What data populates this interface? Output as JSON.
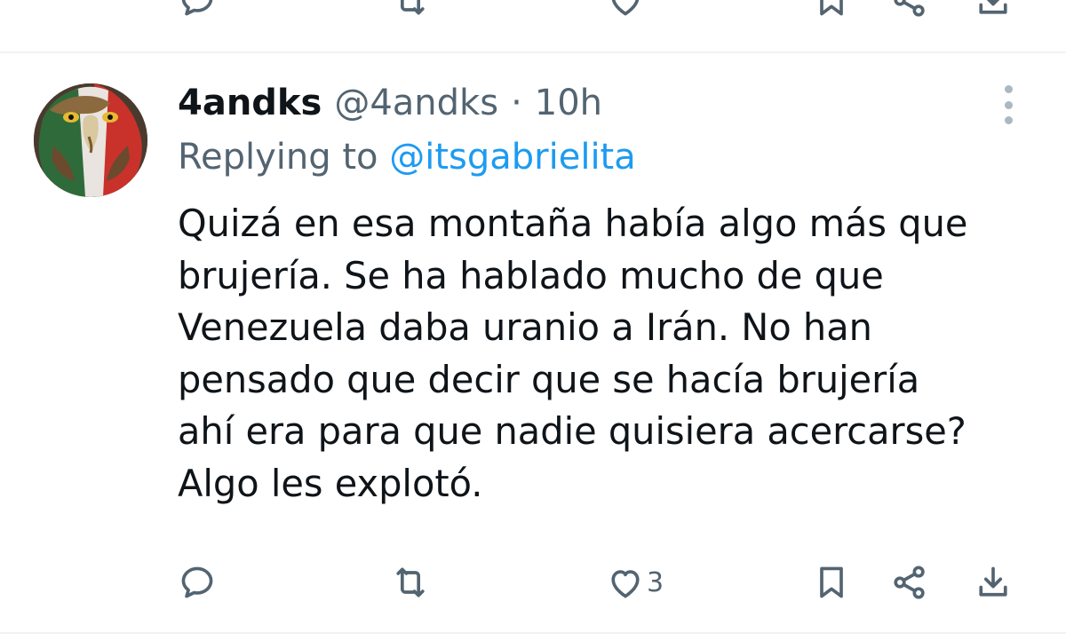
{
  "tweet": {
    "author_name": "4andks",
    "author_handle": "@4andks",
    "separator": "·",
    "time": "10h",
    "reply_prefix": "Replying to",
    "reply_to": "@itsgabrielita",
    "text_lines": [
      "Quizá en esa montaña había algo más que",
      "brujería. Se ha hablado mucho de que",
      "Venezuela daba uranio a Irán. No han",
      "pensado que decir que se hacía brujería",
      "ahí era para que nadie quisiera acercarse?",
      "Algo les explotó."
    ],
    "actions": {
      "reply_count": "",
      "retweet_count": "",
      "like_count": "3"
    }
  },
  "icons": {
    "reply": "reply-bubble-icon",
    "retweet": "retweet-icon",
    "like": "heart-icon",
    "bookmark": "bookmark-icon",
    "share": "share-icon",
    "download": "download-icon",
    "more": "more-vertical-icon"
  },
  "colors": {
    "secondary_text": "#536471",
    "link": "#1d9bf0",
    "primary_text": "#0f1419",
    "divider": "#eff3f4"
  }
}
